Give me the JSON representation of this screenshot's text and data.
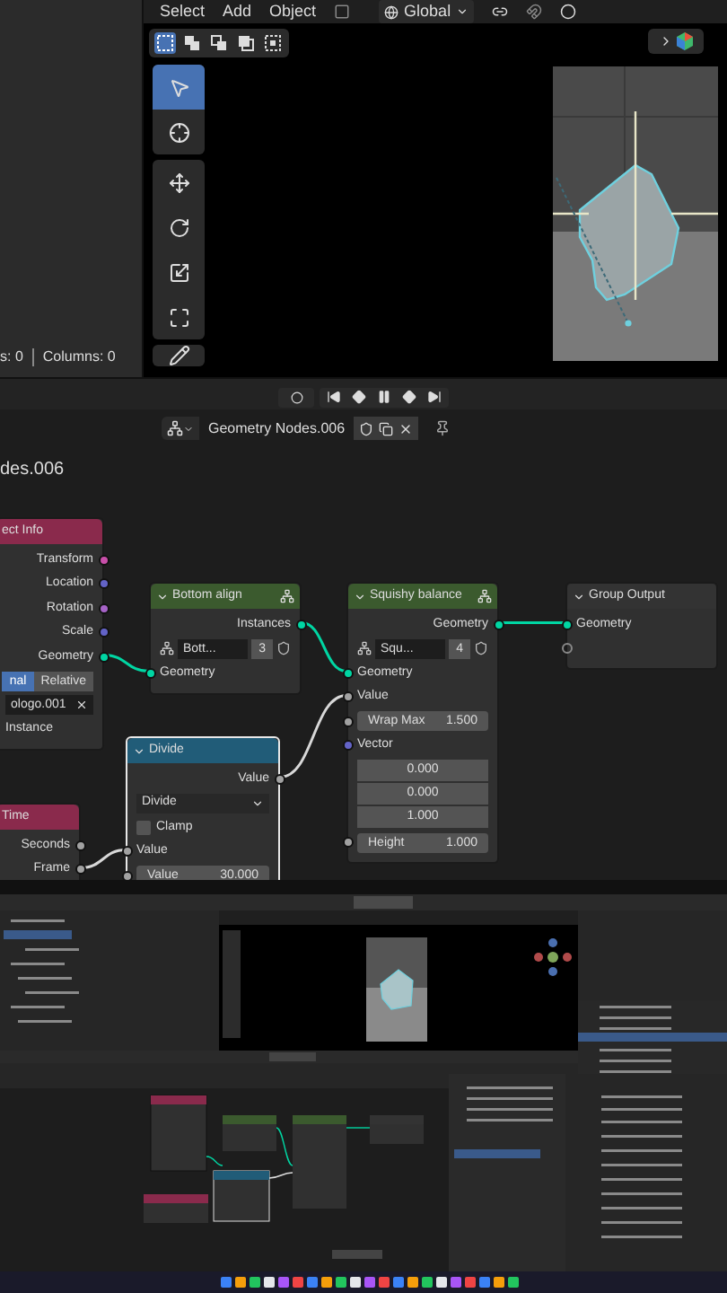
{
  "viewport_header": {
    "menus": [
      "Select",
      "Add",
      "Object"
    ],
    "orientation": "Global"
  },
  "spreadsheet_footer": {
    "rows": "s: 0",
    "columns": "Columns: 0"
  },
  "select_modes": [
    {
      "kind": "set",
      "selected": true
    },
    {
      "kind": "extend",
      "selected": false
    },
    {
      "kind": "subtract",
      "selected": false
    },
    {
      "kind": "invert",
      "selected": false
    },
    {
      "kind": "intersect",
      "selected": false
    }
  ],
  "tools": [
    {
      "kind": "select",
      "selected": true
    },
    {
      "kind": "cursor",
      "selected": false
    },
    {
      "kind": "move",
      "selected": false
    },
    {
      "kind": "rotate",
      "selected": false
    },
    {
      "kind": "scale",
      "selected": false
    },
    {
      "kind": "transform",
      "selected": false
    },
    {
      "kind": "annotate",
      "selected": false
    }
  ],
  "playback": [
    {
      "kind": "jump-start"
    },
    {
      "kind": "prev-key"
    },
    {
      "kind": "pause"
    },
    {
      "kind": "next-key"
    },
    {
      "kind": "jump-end"
    }
  ],
  "node_header": {
    "tree_name": "Geometry Nodes.006"
  },
  "breadcrumb": "des.006",
  "nodes": [
    {
      "title": "ect Info",
      "group_icon": false,
      "color": "#8a2a4c",
      "selected": false,
      "rows": [
        {
          "kind": "output",
          "label": "Transform",
          "color": "#c84fa9"
        },
        {
          "kind": "output",
          "label": "Location",
          "color": "#6363c7"
        },
        {
          "kind": "output",
          "label": "Rotation",
          "color": "#a663c7"
        },
        {
          "kind": "output",
          "label": "Scale",
          "color": "#6363c7"
        },
        {
          "kind": "output",
          "label": "Geometry",
          "color": "#00d6a3"
        },
        {
          "kind": "toggle",
          "options": [
            {
              "label": "nal",
              "selected": true
            },
            {
              "label": "Relative",
              "selected": false
            }
          ]
        },
        {
          "kind": "datablock",
          "value": "ologo.001"
        },
        {
          "kind": "label",
          "label": "Instance"
        }
      ]
    },
    {
      "title": "Bottom align",
      "group_icon": true,
      "color": "#3b5a2e",
      "selected": false,
      "rows": [
        {
          "kind": "output",
          "label": "Instances",
          "color": "#00d6a3"
        },
        {
          "kind": "group",
          "value": "Bott...",
          "users": "3"
        },
        {
          "kind": "input",
          "label": "Geometry",
          "color": "#00d6a3"
        }
      ]
    },
    {
      "title": "Squishy balance",
      "group_icon": true,
      "color": "#3b5a2e",
      "selected": false,
      "rows": [
        {
          "kind": "output",
          "label": "Geometry",
          "color": "#00d6a3"
        },
        {
          "kind": "group",
          "value": "Squ...",
          "users": "4"
        },
        {
          "kind": "input",
          "label": "Geometry",
          "color": "#00d6a3"
        },
        {
          "kind": "input",
          "label": "Value",
          "color": "#a1a1a1"
        },
        {
          "kind": "field",
          "label": "Wrap Max",
          "value": "1.500",
          "color": "#a1a1a1"
        },
        {
          "kind": "input",
          "label": "Vector",
          "color": "#6363c7"
        },
        {
          "kind": "vector",
          "values": [
            "0.000",
            "0.000",
            "1.000"
          ]
        },
        {
          "kind": "field",
          "label": "Height",
          "value": "1.000",
          "color": "#a1a1a1"
        }
      ]
    },
    {
      "title": "Group Output",
      "group_icon": false,
      "color": "#333333",
      "selected": false,
      "rows": [
        {
          "kind": "input",
          "label": "Geometry",
          "color": "#00d6a3"
        },
        {
          "kind": "virtual"
        }
      ]
    },
    {
      "title": "Divide",
      "group_icon": false,
      "color": "#215c78",
      "selected": true,
      "rows": [
        {
          "kind": "output",
          "label": "Value",
          "color": "#a1a1a1"
        },
        {
          "kind": "dropdown",
          "value": "Divide"
        },
        {
          "kind": "checkbox",
          "label": "Clamp",
          "checked": false
        },
        {
          "kind": "input",
          "label": "Value",
          "color": "#a1a1a1"
        },
        {
          "kind": "field",
          "label": "Value",
          "value": "30.000",
          "color": "#a1a1a1"
        }
      ]
    },
    {
      "title": "Time",
      "group_icon": false,
      "color": "#8a2a4c",
      "selected": false,
      "rows": [
        {
          "kind": "output",
          "label": "Seconds",
          "color": "#a1a1a1"
        },
        {
          "kind": "output",
          "label": "Frame",
          "color": "#a1a1a1"
        }
      ]
    }
  ],
  "wires_shown": true
}
